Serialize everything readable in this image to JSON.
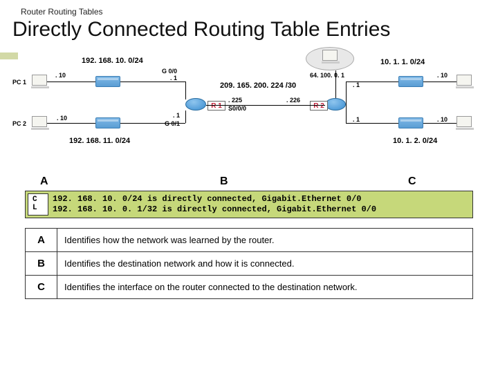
{
  "breadcrumb": "Router Routing Tables",
  "title": "Directly Connected Routing Table Entries",
  "diagram": {
    "net_top_left": "192. 168. 10. 0/24",
    "net_right": "10. 1. 1. 0/24",
    "net_bottom_left": "192. 168. 11. 0/24",
    "net_bottom_right": "10. 1. 2. 0/24",
    "wan": "209. 165. 200. 224 /30",
    "cloud": "64. 100. 0. 1",
    "pc1": "PC 1",
    "pc2": "PC 2",
    "dot10a": ". 10",
    "dot10b": ". 10",
    "dot10c": ". 10",
    "dot10d": ". 10",
    "g00": "G 0/0",
    "g00_1": ". 1",
    "g01_1": ". 1",
    "g01": "G 0/1",
    "r1": "R 1",
    "r2": "R 2",
    "s000": "S0/0/0",
    "d225": ". 225",
    "d226": ". 226",
    "d1a": ". 1",
    "d1b": ". 1"
  },
  "labels": {
    "A": "A",
    "B": "B",
    "C": "C"
  },
  "output": {
    "side1": "C",
    "side2": "L",
    "line1": "192. 168. 10. 0/24 is directly connected, Gigabit.Ethernet 0/0",
    "line2": "192. 168. 10. 0. 1/32 is directly connected, Gigabit.Ethernet 0/0"
  },
  "rows": [
    {
      "key": "A",
      "text": "Identifies how the network was learned by the router."
    },
    {
      "key": "B",
      "text": "Identifies the destination network and how it is connected."
    },
    {
      "key": "C",
      "text": "Identifies the interface on the router connected to the destination network."
    }
  ]
}
